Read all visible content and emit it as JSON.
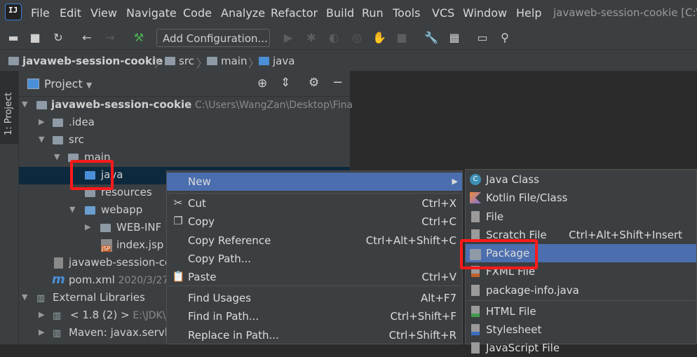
{
  "menubar": {
    "logo_text": "IJ",
    "items": [
      "File",
      "Edit",
      "View",
      "Navigate",
      "Code",
      "Analyze",
      "Refactor",
      "Build",
      "Run",
      "Tools",
      "VCS",
      "Window",
      "Help"
    ],
    "window_title": "javaweb-session-cookie [C:\\"
  },
  "toolbar": {
    "add_configuration": "Add Configuration...",
    "icons": [
      "open-folder-icon",
      "save-icon",
      "sync-icon",
      "back-arrow-icon",
      "forward-arrow-icon",
      "build-hammer-icon",
      "run-icon",
      "debug-icon",
      "coverage-icon",
      "profile-icon",
      "attach-icon",
      "stop-icon",
      "settings-wrench-icon",
      "project-structure-icon",
      "terminal-icon",
      "search-icon"
    ]
  },
  "breadcrumb": [
    "javaweb-session-cookie",
    "src",
    "main",
    "java"
  ],
  "stripe": {
    "tab_label": "1: Project"
  },
  "project_panel": {
    "title": "Project",
    "tree": [
      {
        "label": "javaweb-session-cookie",
        "hint": "C:\\Users\\WangZan\\Desktop\\Fina"
      },
      {
        "label": ".idea"
      },
      {
        "label": "src"
      },
      {
        "label": "main"
      },
      {
        "label": "java"
      },
      {
        "label": "resources"
      },
      {
        "label": "webapp"
      },
      {
        "label": "WEB-INF"
      },
      {
        "label": "index.jsp"
      },
      {
        "label": "javaweb-session-co"
      },
      {
        "label": "pom.xml",
        "hint": "2020/3/27"
      },
      {
        "label": "External Libraries"
      },
      {
        "label": "< 1.8 (2) >",
        "hint": "E:\\JDK\\j"
      },
      {
        "label": "Maven: javax.servle"
      }
    ]
  },
  "context_menu": [
    {
      "label": "New",
      "shortcut": ""
    },
    {
      "label": "Cut",
      "shortcut": "Ctrl+X"
    },
    {
      "label": "Copy",
      "shortcut": "Ctrl+C"
    },
    {
      "label": "Copy Reference",
      "shortcut": "Ctrl+Alt+Shift+C"
    },
    {
      "label": "Copy Path...",
      "shortcut": ""
    },
    {
      "label": "Paste",
      "shortcut": "Ctrl+V"
    },
    {
      "label": "Find Usages",
      "shortcut": "Alt+F7"
    },
    {
      "label": "Find in Path...",
      "shortcut": "Ctrl+Shift+F"
    },
    {
      "label": "Replace in Path...",
      "shortcut": "Ctrl+Shift+R"
    }
  ],
  "submenu": [
    {
      "label": "Java Class",
      "shortcut": ""
    },
    {
      "label": "Kotlin File/Class",
      "shortcut": ""
    },
    {
      "label": "File",
      "shortcut": ""
    },
    {
      "label": "Scratch File",
      "shortcut": "Ctrl+Alt+Shift+Insert"
    },
    {
      "label": "Package",
      "shortcut": ""
    },
    {
      "label": "FXML File",
      "shortcut": ""
    },
    {
      "label": "package-info.java",
      "shortcut": ""
    },
    {
      "label": "HTML File",
      "shortcut": ""
    },
    {
      "label": "Stylesheet",
      "shortcut": ""
    },
    {
      "label": "JavaScript File",
      "shortcut": ""
    }
  ],
  "colors": {
    "highlight": "#4b6eaf",
    "annotation": "#ff1a1a",
    "selection": "#0d293e"
  }
}
